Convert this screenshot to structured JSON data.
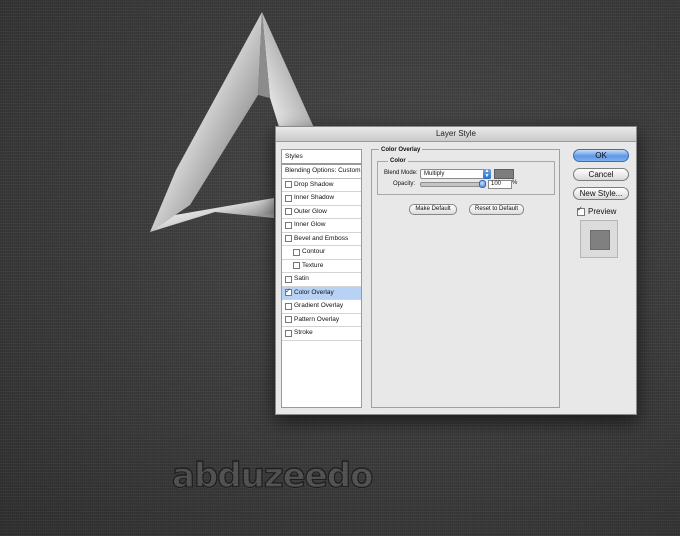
{
  "brand": {
    "text": "abduzeedo"
  },
  "dialog": {
    "title": "Layer Style",
    "styles_panel": {
      "header": "Styles",
      "blending_options": "Blending Options: Custom",
      "items": [
        {
          "label": "Drop Shadow",
          "checked": false,
          "indent": false,
          "selected": false
        },
        {
          "label": "Inner Shadow",
          "checked": false,
          "indent": false,
          "selected": false
        },
        {
          "label": "Outer Glow",
          "checked": false,
          "indent": false,
          "selected": false
        },
        {
          "label": "Inner Glow",
          "checked": false,
          "indent": false,
          "selected": false
        },
        {
          "label": "Bevel and Emboss",
          "checked": false,
          "indent": false,
          "selected": false
        },
        {
          "label": "Contour",
          "checked": false,
          "indent": true,
          "selected": false
        },
        {
          "label": "Texture",
          "checked": false,
          "indent": true,
          "selected": false
        },
        {
          "label": "Satin",
          "checked": false,
          "indent": false,
          "selected": false
        },
        {
          "label": "Color Overlay",
          "checked": true,
          "indent": false,
          "selected": true
        },
        {
          "label": "Gradient Overlay",
          "checked": false,
          "indent": false,
          "selected": false
        },
        {
          "label": "Pattern Overlay",
          "checked": false,
          "indent": false,
          "selected": false
        },
        {
          "label": "Stroke",
          "checked": false,
          "indent": false,
          "selected": false
        }
      ]
    },
    "color_overlay": {
      "section_title": "Color Overlay",
      "group_title": "Color",
      "blend_mode_label": "Blend Mode:",
      "blend_mode_value": "Multiply",
      "overlay_color": "#7d7d7d",
      "opacity_label": "Opacity:",
      "opacity_value": "100",
      "opacity_unit": "%",
      "opacity_fraction": 1.0,
      "make_default": "Make Default",
      "reset_default": "Reset to Default"
    },
    "buttons": {
      "ok": "OK",
      "cancel": "Cancel",
      "new_style": "New Style...",
      "preview": "Preview",
      "preview_checked": true
    }
  }
}
